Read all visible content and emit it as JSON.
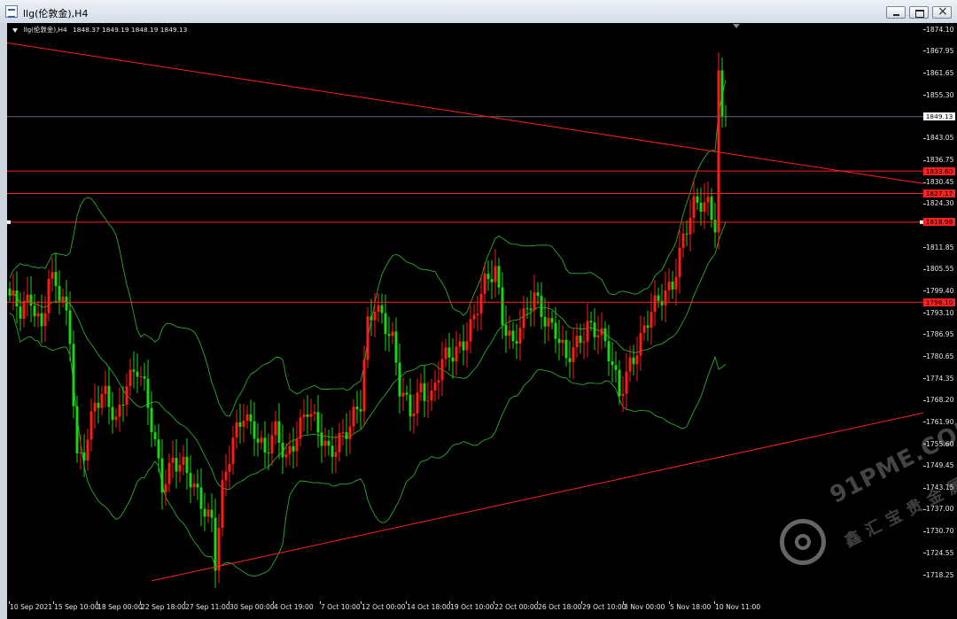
{
  "window": {
    "title": "llg(伦敦金),H4"
  },
  "chart_header": {
    "symbol_timeframe": "llg(伦敦金),H4",
    "ohlc": "1848.37 1849.19 1848.19 1849.13"
  },
  "price_axis_labels": [
    "1874.10",
    "1867.95",
    "1861.65",
    "1855.30",
    "1849.13",
    "1843.05",
    "1836.75",
    "1833.60",
    "1830.45",
    "1827.17",
    "1824.30",
    "1818.98",
    "1811.85",
    "1805.55",
    "1799.40",
    "1796.10",
    "1793.10",
    "1786.95",
    "1780.65",
    "1774.35",
    "1768.20",
    "1761.90",
    "1755.60",
    "1749.45",
    "1743.15",
    "1737.00",
    "1730.70",
    "1724.55",
    "1718.25"
  ],
  "highlight_labels": {
    "current_price": "1849.13",
    "level_1": "1833.60",
    "level_2": "1827.17",
    "level_3": "1818.98",
    "level_4": "1796.10"
  },
  "time_axis_labels": [
    "10 Sep 2021",
    "15 Sep 10:00",
    "18 Sep 00:00",
    "22 Sep 18:00",
    "27 Sep 11:00",
    "30 Sep 00:00",
    "4 Oct 19:00",
    "7 Oct 10:00",
    "12 Oct 00:00",
    "14 Oct 18:00",
    "19 Oct 10:00",
    "22 Oct 00:00",
    "26 Oct 18:00",
    "29 Oct 10:00",
    "3 Nov 00:00",
    "5 Nov 18:00",
    "10 Nov 11:00"
  ],
  "colors": {
    "background": "#000000",
    "bull_candle": "#ff1a1a",
    "bear_candle": "#19d419",
    "bollinger": "#2ea82e",
    "trendline": "#ff2020",
    "hline": "#ff2020",
    "current_price_line": "#5f6b78",
    "highlight_bg": "#ff2020"
  },
  "watermark": {
    "text": "91PME.COM",
    "subtext": "鑫汇宝贵金属"
  },
  "chart_data": {
    "type": "candlestick",
    "symbol": "llg(伦敦金)",
    "timeframe": "H4",
    "ylim": [
      1718.25,
      1874.1
    ],
    "last_price": 1849.13,
    "horizontal_levels": [
      1833.6,
      1827.17,
      1818.98,
      1796.1
    ],
    "trendlines": [
      {
        "from": {
          "bar": 0,
          "price": 1870.2
        },
        "to": {
          "bar": 220,
          "price": 1830.0
        }
      },
      {
        "from": {
          "bar": 40,
          "price": 1716.5
        },
        "to": {
          "bar": 220,
          "price": 1764.5
        }
      }
    ],
    "indicator": "Bollinger Bands",
    "close_path": [
      [
        0,
        1798
      ],
      [
        3,
        1792
      ],
      [
        6,
        1797
      ],
      [
        9,
        1790
      ],
      [
        11,
        1804
      ],
      [
        13,
        1800
      ],
      [
        15,
        1795
      ],
      [
        17,
        1785
      ],
      [
        19,
        1752
      ],
      [
        21,
        1755
      ],
      [
        24,
        1767
      ],
      [
        27,
        1768
      ],
      [
        30,
        1762
      ],
      [
        33,
        1775
      ],
      [
        36,
        1777
      ],
      [
        38,
        1770
      ],
      [
        40,
        1760
      ],
      [
        43,
        1745
      ],
      [
        46,
        1752
      ],
      [
        49,
        1748
      ],
      [
        52,
        1742
      ],
      [
        55,
        1738
      ],
      [
        57,
        1735
      ],
      [
        58,
        1723
      ],
      [
        60,
        1742
      ],
      [
        63,
        1755
      ],
      [
        66,
        1765
      ],
      [
        69,
        1761
      ],
      [
        72,
        1752
      ],
      [
        75,
        1758
      ],
      [
        78,
        1752
      ],
      [
        81,
        1760
      ],
      [
        84,
        1765
      ],
      [
        87,
        1758
      ],
      [
        90,
        1754
      ],
      [
        93,
        1758
      ],
      [
        96,
        1760
      ],
      [
        99,
        1766
      ],
      [
        101,
        1790
      ],
      [
        103,
        1797
      ],
      [
        105,
        1793
      ],
      [
        108,
        1784
      ],
      [
        110,
        1770
      ],
      [
        113,
        1765
      ],
      [
        116,
        1773
      ],
      [
        119,
        1768
      ],
      [
        122,
        1778
      ],
      [
        125,
        1782
      ],
      [
        128,
        1786
      ],
      [
        131,
        1791
      ],
      [
        134,
        1800
      ],
      [
        137,
        1806
      ],
      [
        139,
        1793
      ],
      [
        142,
        1784
      ],
      [
        145,
        1790
      ],
      [
        148,
        1798
      ],
      [
        151,
        1793
      ],
      [
        154,
        1788
      ],
      [
        157,
        1778
      ],
      [
        160,
        1784
      ],
      [
        163,
        1791
      ],
      [
        166,
        1788
      ],
      [
        169,
        1780
      ],
      [
        172,
        1770
      ],
      [
        175,
        1780
      ],
      [
        178,
        1785
      ],
      [
        181,
        1792
      ],
      [
        184,
        1798
      ],
      [
        187,
        1803
      ],
      [
        190,
        1814
      ],
      [
        193,
        1822
      ],
      [
        195,
        1824
      ],
      [
        197,
        1825
      ],
      [
        199,
        1820
      ],
      [
        200,
        1862
      ],
      [
        201,
        1848
      ],
      [
        202,
        1849.13
      ]
    ]
  }
}
